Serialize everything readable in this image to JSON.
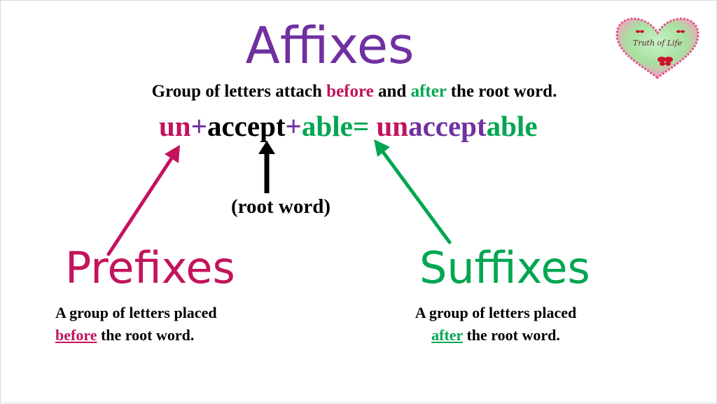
{
  "title": "Affixes",
  "subtitle": {
    "part1": "Group of letters attach ",
    "before": "before",
    "part2": " and ",
    "after": "after",
    "part3": " the root word."
  },
  "formula": {
    "prefix": "un",
    "plus1": "+",
    "root": "accept",
    "plus2": "+",
    "suffix": "able",
    "equals": "= ",
    "result_prefix": "un",
    "result_root": "accept",
    "result_suffix": "able"
  },
  "root_label": "(root word)",
  "prefixes": {
    "heading": "Prefixes",
    "line1": "A group of letters placed",
    "keyword": "before",
    "line2_rest": " the root word."
  },
  "suffixes": {
    "heading": "Suffixes",
    "line1": "A group of letters placed",
    "keyword": "after",
    "line2_rest": " the root word."
  },
  "logo": {
    "text": "Truth of Life",
    "icon": "heart-butterfly-logo"
  },
  "colors": {
    "purple": "#7030a0",
    "pink": "#c3135c",
    "green": "#00a651",
    "black": "#000000"
  }
}
